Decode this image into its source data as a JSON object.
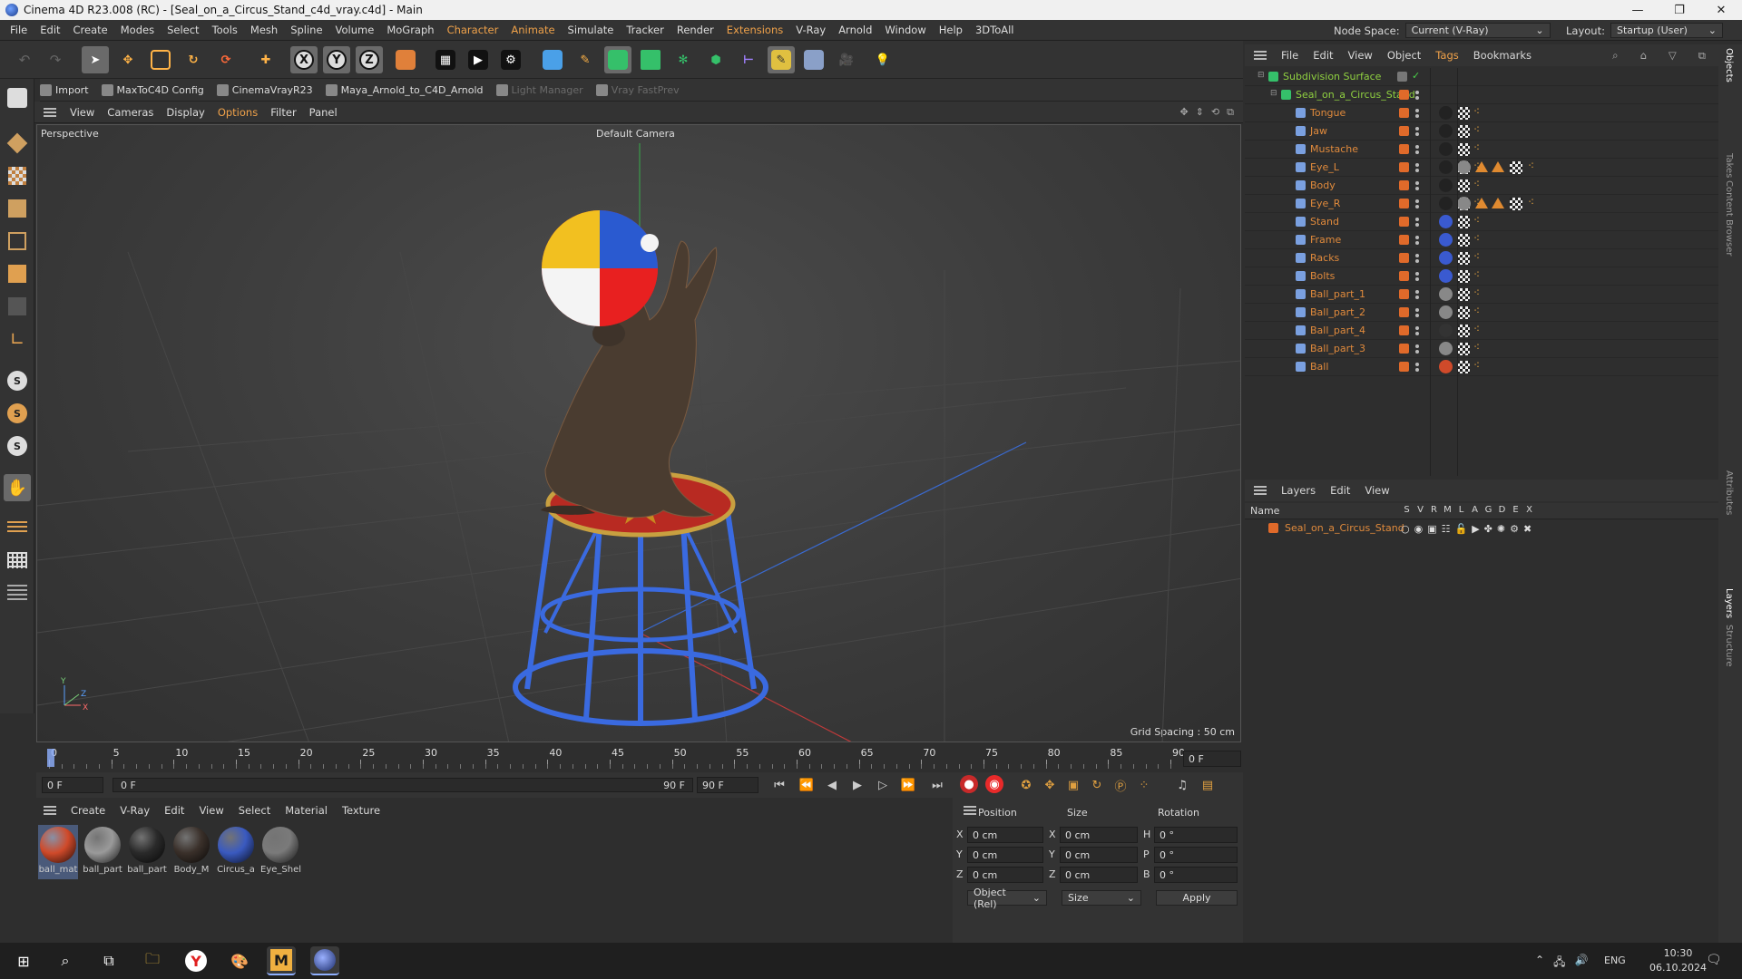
{
  "window": {
    "title": "Cinema 4D R23.008 (RC) - [Seal_on_a_Circus_Stand_c4d_vray.c4d] - Main"
  },
  "menu": {
    "items": [
      "File",
      "Edit",
      "Create",
      "Modes",
      "Select",
      "Tools",
      "Mesh",
      "Spline",
      "Volume",
      "MoGraph",
      "Character",
      "Animate",
      "Simulate",
      "Tracker",
      "Render",
      "Extensions",
      "V-Ray",
      "Arnold",
      "Window",
      "Help",
      "3DToAll"
    ],
    "node_space_label": "Node Space:",
    "node_space_value": "Current (V-Ray)",
    "layout_label": "Layout:",
    "layout_value": "Startup (User)"
  },
  "plugins": {
    "items": [
      "Import",
      "MaxToC4D Config",
      "CinemaVrayR23",
      "Maya_Arnold_to_C4D_Arnold",
      "Light Manager",
      "Vray FastPrev"
    ]
  },
  "viewport_menu": {
    "items": [
      "View",
      "Cameras",
      "Display",
      "Options",
      "Filter",
      "Panel"
    ]
  },
  "viewport": {
    "label": "Perspective",
    "camera": "Default Camera",
    "grid_spacing": "Grid Spacing : 50 cm",
    "axis_x": "X",
    "axis_y": "Y",
    "axis_z": "Z"
  },
  "timeline": {
    "ticks": [
      "0",
      "5",
      "10",
      "15",
      "20",
      "25",
      "30",
      "35",
      "40",
      "45",
      "50",
      "55",
      "60",
      "65",
      "70",
      "75",
      "80",
      "85",
      "90"
    ],
    "current_frame": "0 F",
    "start_field": "0 F",
    "preview_start": "0 F",
    "preview_end": "90 F",
    "end_field": "90 F"
  },
  "materials": {
    "menu": [
      "Create",
      "V-Ray",
      "Edit",
      "View",
      "Select",
      "Material",
      "Texture"
    ],
    "items": [
      {
        "label": "ball_mat",
        "color": "#d04a2a"
      },
      {
        "label": "ball_part",
        "color": "#9a9a9a"
      },
      {
        "label": "ball_part",
        "color": "#2a2a2a"
      },
      {
        "label": "Body_M",
        "color": "#3a302a"
      },
      {
        "label": "Circus_a",
        "color": "#3a5ac0"
      },
      {
        "label": "Eye_Shel",
        "color": "#7a7a7a"
      }
    ]
  },
  "coords": {
    "headers": [
      "Position",
      "Size",
      "Rotation"
    ],
    "rows": [
      {
        "axis": "X",
        "pos": "0 cm",
        "saxis": "X",
        "size": "0 cm",
        "raxis": "H",
        "rot": "0 °"
      },
      {
        "axis": "Y",
        "pos": "0 cm",
        "saxis": "Y",
        "size": "0 cm",
        "raxis": "P",
        "rot": "0 °"
      },
      {
        "axis": "Z",
        "pos": "0 cm",
        "saxis": "Z",
        "size": "0 cm",
        "raxis": "B",
        "rot": "0 °"
      }
    ],
    "mode": "Object (Rel)",
    "size_mode": "Size",
    "apply": "Apply"
  },
  "objects": {
    "menu": [
      "File",
      "Edit",
      "View",
      "Object",
      "Tags",
      "Bookmarks"
    ],
    "root": "Subdivision Surface",
    "group": "Seal_on_a_Circus_Stand",
    "children": [
      "Tongue",
      "Jaw",
      "Mustache",
      "Eye_L",
      "Body",
      "Eye_R",
      "Stand",
      "Frame",
      "Racks",
      "Bolts",
      "Ball_part_1",
      "Ball_part_2",
      "Ball_part_4",
      "Ball_part_3",
      "Ball"
    ]
  },
  "layers": {
    "menu": [
      "Layers",
      "Edit",
      "View"
    ],
    "name_header": "Name",
    "cols": [
      "S",
      "V",
      "R",
      "M",
      "L",
      "A",
      "G",
      "D",
      "E",
      "X"
    ],
    "items": [
      "Seal_on_a_Circus_Stand"
    ]
  },
  "side_tabs": [
    "Objects",
    "Takes",
    "Content Browser",
    "Attributes",
    "Layers",
    "Structure"
  ],
  "taskbar": {
    "lang": "ENG",
    "time": "10:30",
    "date": "06.10.2024"
  },
  "colors": {
    "accent": "#f0a24a",
    "object_name": "#e08a3c",
    "layer_color": "#e06a2a"
  }
}
